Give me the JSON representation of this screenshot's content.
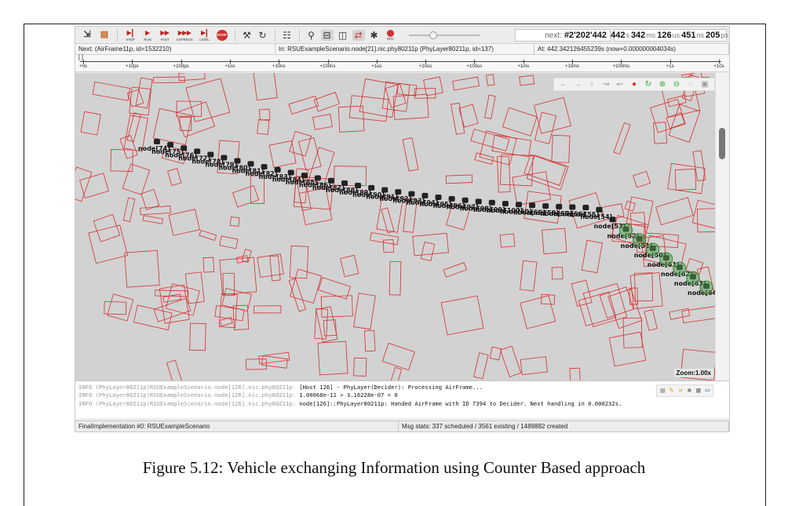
{
  "toolbar": {
    "buttons": [
      {
        "name": "new-run-icon",
        "label": ""
      },
      {
        "name": "open-network-icon",
        "label": ""
      },
      {
        "name": "step-button",
        "label": "STEP"
      },
      {
        "name": "run-button",
        "label": "RUN"
      },
      {
        "name": "fast-button",
        "label": "FAST"
      },
      {
        "name": "express-button",
        "label": "EXPRESS"
      },
      {
        "name": "until-button",
        "label": "UNTIL"
      },
      {
        "name": "stop-button",
        "label": "STOP"
      }
    ],
    "rec_label": "REC",
    "next_label": "next:",
    "next_value": "#2'202'442",
    "time": {
      "s": "442",
      "ms": "342",
      "us": "126",
      "ns": "451",
      "ps": "205"
    }
  },
  "infobar": {
    "next": "Next:  (AirFrame11p, id=1532210)",
    "in": "In: RSUExampleScenario.node[21].nic.phy80211p (PhyLayer80211p, id=137)",
    "at": "At: 442.342126455239s (now+0.000000004034s)"
  },
  "ruler": {
    "bracket": "[  ]",
    "ticks": [
      "+0s",
      "+10ps",
      "+100ps",
      "+1ns",
      "+10ns",
      "+100ns",
      "+1us",
      "+10us",
      "+100us",
      "+1ms",
      "+10ms",
      "+100ms",
      "+1s",
      "+10s"
    ]
  },
  "canvas": {
    "zoom": "Zoom:1.00x",
    "nodes": [
      "node[74]",
      "node[75]",
      "node[76]",
      "node[77]",
      "node[78]",
      "node[79]",
      "node[80]",
      "node[81]",
      "node[82]",
      "node[83]",
      "node[84]",
      "node[85]",
      "node[86]",
      "node[87]",
      "node[88]",
      "node[89]",
      "node[90]",
      "node[91]",
      "node[92]",
      "node[93]",
      "node[94]",
      "node[95]",
      "node[96]",
      "node[97]",
      "node[98]",
      "node[99]",
      "node[100]",
      "node[60]",
      "node[59]",
      "node[58]",
      "node[57]",
      "node[56]",
      "node[55]",
      "node[54]",
      "node[53]",
      "node[52]",
      "node[51]",
      "node[50]",
      "node[61]",
      "node[62]",
      "node[63]",
      "node[64]"
    ]
  },
  "log": [
    {
      "src": "INFO (PhyLayer80211p)RSUExampleScenario.node[126].nic.phy80211p:",
      "msg": "[Host 126] - PhyLayer(Decider): Processing AirFrame..."
    },
    {
      "src": "INFO (PhyLayer80211p)RSUExampleScenario.node[126].nic.phy80211p:",
      "msg": "1.00068e-11 > 3.16228e-07 = 0"
    },
    {
      "src": "INFO (PhyLayer80211p)RSUExampleScenario.node[126].nic.phy80211p:",
      "msg": "node[126]::PhyLayer80211p: Handed AirFrame with ID 7394 to Decider. Next handling in 0.000232s."
    }
  ],
  "status": {
    "left": "FinalImplementation #0: RSUExampleScenario",
    "right": "Msg stats: 337 scheduled / 3561 existing / 1489882 created"
  },
  "caption": "Figure 5.12: Vehicle exchanging Information using Counter Based approach"
}
